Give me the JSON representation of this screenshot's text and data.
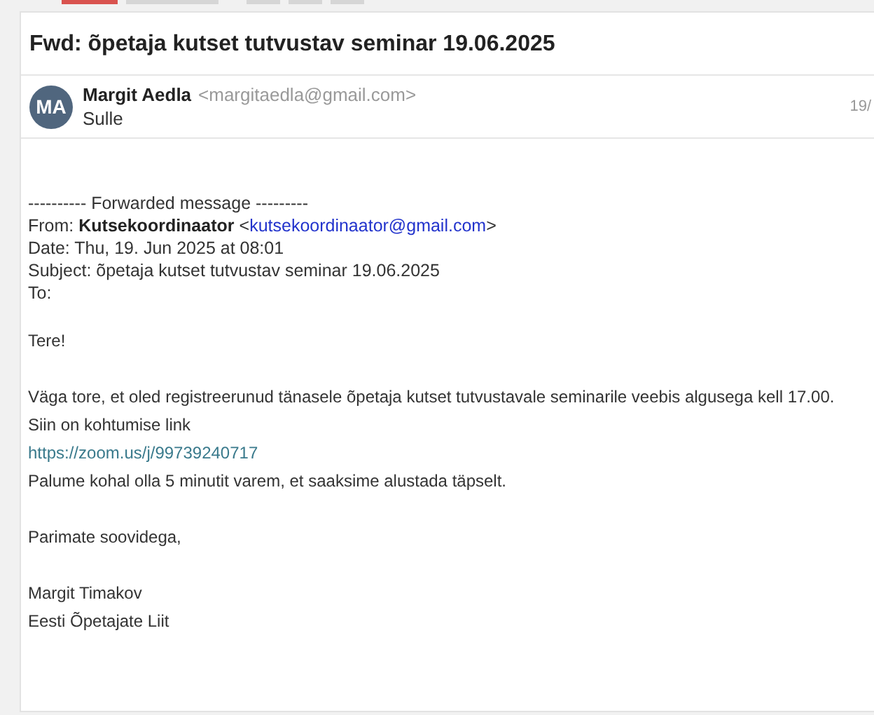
{
  "subject": "Fwd: õpetaja kutset tutvustav seminar 19.06.2025",
  "sender": {
    "initials": "MA",
    "name": "Margit Aedla",
    "email": "<margitaedla@gmail.com>",
    "recipient": "Sulle",
    "date": "19/"
  },
  "forwarded": {
    "separator": "---------- Forwarded message ---------",
    "from_label": "From:",
    "from_name": "Kutsekoordinaator",
    "from_email_open": "<",
    "from_email": "kutsekoordinaator@gmail.com",
    "from_email_close": ">",
    "date": "Date: Thu, 19. Jun 2025 at 08:01",
    "subject": "Subject: õpetaja kutset tutvustav seminar 19.06.2025",
    "to": "To:"
  },
  "body": [
    [
      {
        "kind": "text",
        "text": "Tere!"
      }
    ],
    [
      {
        "kind": "text",
        "text": "Väga tore, et oled registreerunud tänasele õpetaja kutset tutvustavale seminarile veebis algusega kell 17.00."
      },
      {
        "kind": "text",
        "text": "Siin on kohtumise link"
      },
      {
        "kind": "link",
        "text": "https://zoom.us/j/99739240717"
      },
      {
        "kind": "text",
        "text": "Palume kohal olla 5 minutit varem, et saaksime alustada täpselt."
      }
    ],
    [
      {
        "kind": "text",
        "text": "Parimate soovidega,"
      }
    ],
    [
      {
        "kind": "text",
        "text": "Margit Timakov"
      },
      {
        "kind": "text",
        "text": "Eesti Õpetajate Liit"
      }
    ]
  ]
}
